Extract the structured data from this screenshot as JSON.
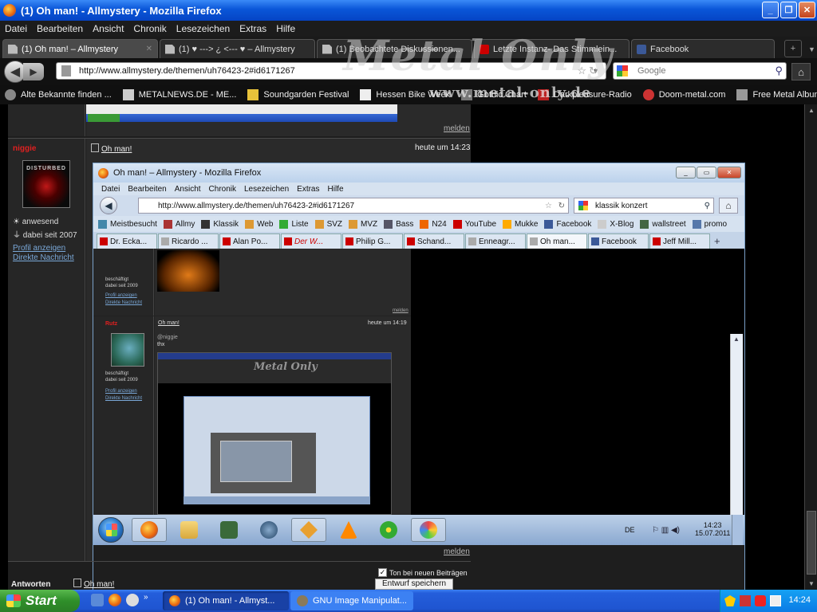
{
  "window": {
    "title": "(1) Oh man! - Allmystery - Mozilla Firefox"
  },
  "menu": [
    "Datei",
    "Bearbeiten",
    "Ansicht",
    "Chronik",
    "Lesezeichen",
    "Extras",
    "Hilfe"
  ],
  "tabs": [
    {
      "label": "(1) Oh man! – Allmystery",
      "icon": "page",
      "active": true
    },
    {
      "label": "(1) ♥ ---> ¿ <--- ♥ – Allmystery",
      "icon": "page",
      "active": false
    },
    {
      "label": "(1) Beobachtete Diskussionen...",
      "icon": "page",
      "active": false
    },
    {
      "label": "Letzte Instanz- Das Stimmlein...",
      "icon": "youtube",
      "active": false
    },
    {
      "label": "Facebook",
      "icon": "facebook",
      "active": false
    }
  ],
  "nav": {
    "url": "http://www.allmystery.de/themen/uh76423-2#id6171267",
    "search_placeholder": "Google"
  },
  "bookmarks": [
    {
      "label": "Alte Bekannte finden ...",
      "icon": "people-icon"
    },
    {
      "label": "METALNEWS.DE - ME...",
      "icon": "skull-icon"
    },
    {
      "label": "Soundgarden Festival",
      "icon": "sg-icon"
    },
    {
      "label": "Hessen Bike Week",
      "icon": "h-icon"
    },
    {
      "label": "Gothic Chart",
      "icon": "gothic-icon"
    },
    {
      "label": "Darkpleasure-Radio",
      "icon": "dpr-icon"
    },
    {
      "label": "Doom-metal.com",
      "icon": "doom-icon"
    },
    {
      "label": "Free Metal Albums",
      "icon": "album-icon"
    }
  ],
  "overlay": {
    "brand": "Metal Only",
    "url": "www.metal-only.de"
  },
  "forum": {
    "melden": "melden",
    "post": {
      "username": "niggie",
      "avatar_text": "DISTURBED",
      "status": "anwesend",
      "since": "dabei seit 2007",
      "profile_link": "Profil anzeigen",
      "message_link": "Direkte Nachricht",
      "title": "Oh man!",
      "time": "heute um 14:23"
    },
    "answer_label": "Antworten",
    "bottom_link": "Oh man!",
    "sound_label": "Ton bei neuen Beiträgen",
    "draft_button": "Entwurf speichern"
  },
  "inner": {
    "title": "Oh man! – Allmystery - Mozilla Firefox",
    "menu": [
      "Datei",
      "Bearbeiten",
      "Ansicht",
      "Chronik",
      "Lesezeichen",
      "Extras",
      "Hilfe"
    ],
    "url": "http://www.allmystery.de/themen/uh76423-2#id6171267",
    "search": "klassik konzert",
    "bookmarks": [
      "Meistbesucht",
      "Allmy",
      "Klassik",
      "Web",
      "Liste",
      "SVZ",
      "MVZ",
      "Bass",
      "N24",
      "YouTube",
      "Mukke",
      "Facebook",
      "X-Blog",
      "wallstreet",
      "promo"
    ],
    "tabs": [
      {
        "label": "Dr. Ecka...",
        "icon": "youtube"
      },
      {
        "label": "Ricardo ...",
        "icon": "page"
      },
      {
        "label": "Alan Po...",
        "icon": "youtube"
      },
      {
        "label": "Der W...",
        "icon": "youtube"
      },
      {
        "label": "Philip G...",
        "icon": "youtube"
      },
      {
        "label": "Schand...",
        "icon": "youtube"
      },
      {
        "label": "Enneagr...",
        "icon": "page"
      },
      {
        "label": "Oh man...",
        "icon": "page"
      },
      {
        "label": "Facebook",
        "icon": "facebook"
      },
      {
        "label": "Jeff Mill...",
        "icon": "youtube"
      }
    ],
    "post1": {
      "status": "beschäftigt",
      "since": "dabei seit 2009",
      "profile_link": "Profil anzeigen",
      "message_link": "Direkte Nachricht",
      "melden": "melden"
    },
    "post2": {
      "username": "Rutz",
      "title": "Oh man!",
      "time": "heute um 14:19",
      "mention": "@niggie",
      "text": "thx",
      "status": "beschäftigt",
      "since": "dabei seit 2009",
      "profile_link": "Profil anzeigen",
      "message_link": "Direkte Nachricht"
    },
    "taskbar": {
      "lang": "DE",
      "time": "14:23",
      "date": "15.07.2011"
    }
  },
  "xp_taskbar": {
    "start_label": "Start",
    "tasks": [
      {
        "label": "(1) Oh man! - Allmyst...",
        "icon": "firefox-icon"
      },
      {
        "label": "GNU Image Manipulat...",
        "icon": "gimp-icon"
      }
    ],
    "time": "14:24"
  }
}
